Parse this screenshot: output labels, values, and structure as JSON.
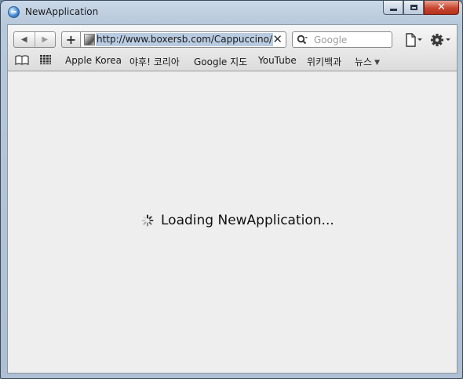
{
  "window": {
    "title": "NewApplication",
    "close_glyph": "✕"
  },
  "toolbar": {
    "back_glyph": "◀",
    "forward_glyph": "▶",
    "add_glyph": "+",
    "url": "http://www.boxersb.com/Cappuccino/NewApplication/",
    "url_clear_glyph": "✕",
    "search_placeholder": "Google"
  },
  "bookmarks": {
    "items": [
      {
        "label": "Apple Korea"
      },
      {
        "label": "야후! 코리아"
      },
      {
        "label": "Google 지도"
      },
      {
        "label": "YouTube"
      },
      {
        "label": "위키백과"
      },
      {
        "label": "뉴스",
        "dropdown": true
      }
    ],
    "dropdown_glyph": "▼"
  },
  "content": {
    "loading_text": "Loading NewApplication..."
  },
  "colors": {
    "frame": "#b7c8da",
    "close_button": "#c8452f",
    "url_selection": "#b9cbe0",
    "content_bg": "#eeeeee"
  }
}
